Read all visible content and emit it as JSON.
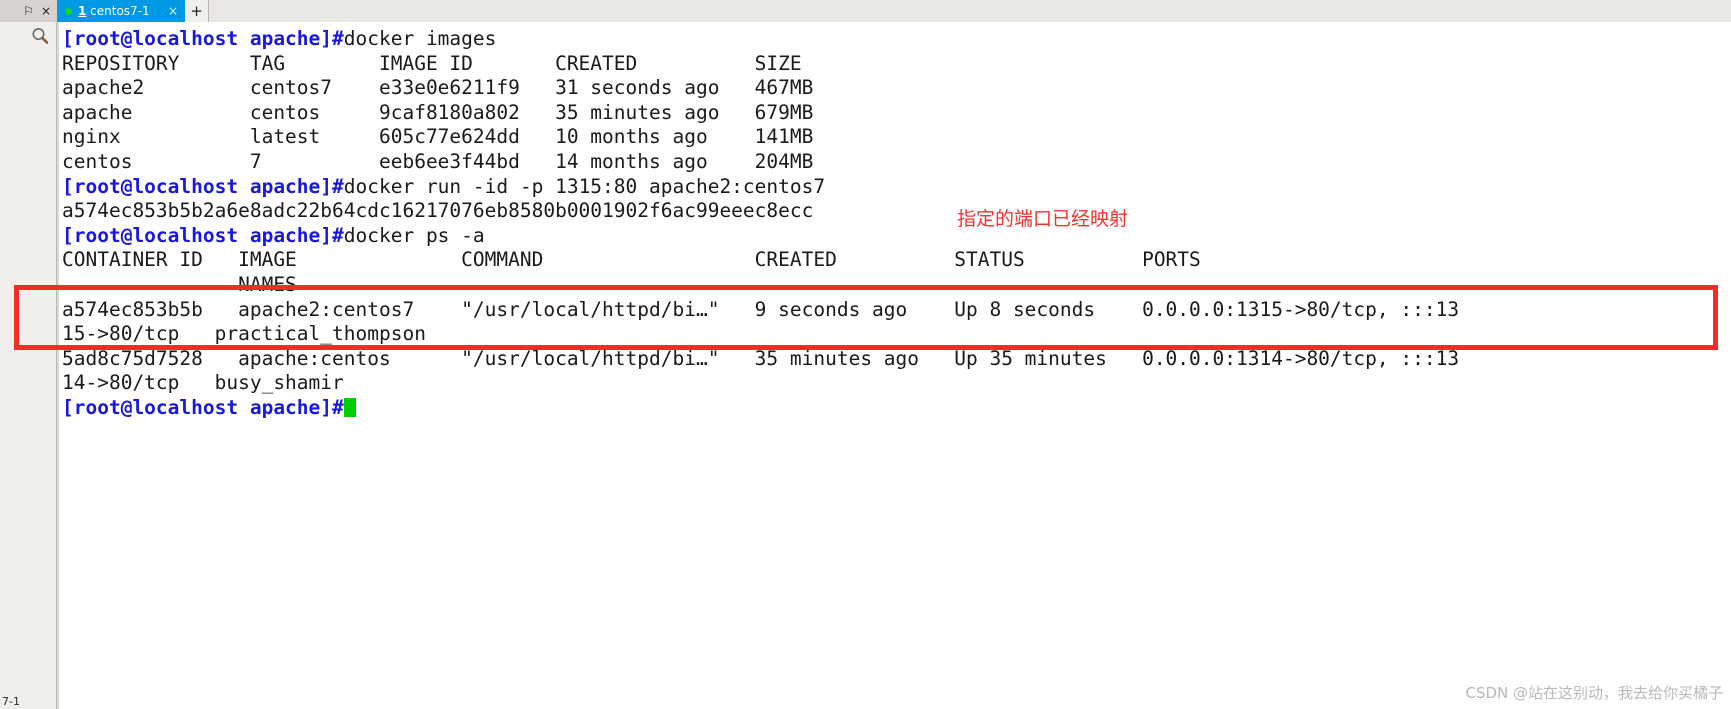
{
  "window": {
    "tab": {
      "index": "1",
      "name": " centos7-1",
      "close_label": "×",
      "new_tab_label": "+"
    },
    "controls": {
      "pin_label": "⚐",
      "close_label": "×"
    },
    "sidebar": {
      "search_icon": "search-icon",
      "bottom_label": "7-1"
    }
  },
  "terminal": {
    "prompt": "[root@localhost apache]#",
    "lines": [
      {
        "type": "prompt",
        "command": "docker images"
      },
      {
        "type": "out",
        "text": "REPOSITORY      TAG        IMAGE ID       CREATED          SIZE"
      },
      {
        "type": "out",
        "text": "apache2         centos7    e33e0e6211f9   31 seconds ago   467MB"
      },
      {
        "type": "out",
        "text": "apache          centos     9caf8180a802   35 minutes ago   679MB"
      },
      {
        "type": "out",
        "text": "nginx           latest     605c77e624dd   10 months ago    141MB"
      },
      {
        "type": "out",
        "text": "centos          7          eeb6ee3f44bd   14 months ago    204MB"
      },
      {
        "type": "prompt",
        "command": "docker run -id -p 1315:80 apache2:centos7"
      },
      {
        "type": "out",
        "text": "a574ec853b5b2a6e8adc22b64cdc16217076eb8580b0001902f6ac99eeec8ecc"
      },
      {
        "type": "prompt",
        "command": "docker ps -a"
      },
      {
        "type": "out",
        "text": "CONTAINER ID   IMAGE              COMMAND                  CREATED          STATUS          PORTS"
      },
      {
        "type": "out",
        "text": "               NAMES"
      },
      {
        "type": "out",
        "text": "a574ec853b5b   apache2:centos7    \"/usr/local/httpd/bi…\"   9 seconds ago    Up 8 seconds    0.0.0.0:1315->80/tcp, :::13"
      },
      {
        "type": "out",
        "text": "15->80/tcp   practical_thompson"
      },
      {
        "type": "out",
        "text": "5ad8c75d7528   apache:centos      \"/usr/local/httpd/bi…\"   35 minutes ago   Up 35 minutes   0.0.0.0:1314->80/tcp, :::13"
      },
      {
        "type": "out",
        "text": "14->80/tcp   busy_shamir"
      },
      {
        "type": "prompt-cursor",
        "command": ""
      }
    ]
  },
  "annotation": {
    "text": "指定的端口已经映射",
    "color": "#f8312f"
  },
  "highlight": {
    "color": "#fa2a2a",
    "label": "highlighted-container-row"
  },
  "watermark": {
    "text": "CSDN @站在这别动，我去给你买橘子"
  },
  "colors": {
    "prompt": "#1818e0",
    "tab_active": "#0099e5",
    "cursor": "#00d000",
    "chrome": "#d6d3ce"
  }
}
